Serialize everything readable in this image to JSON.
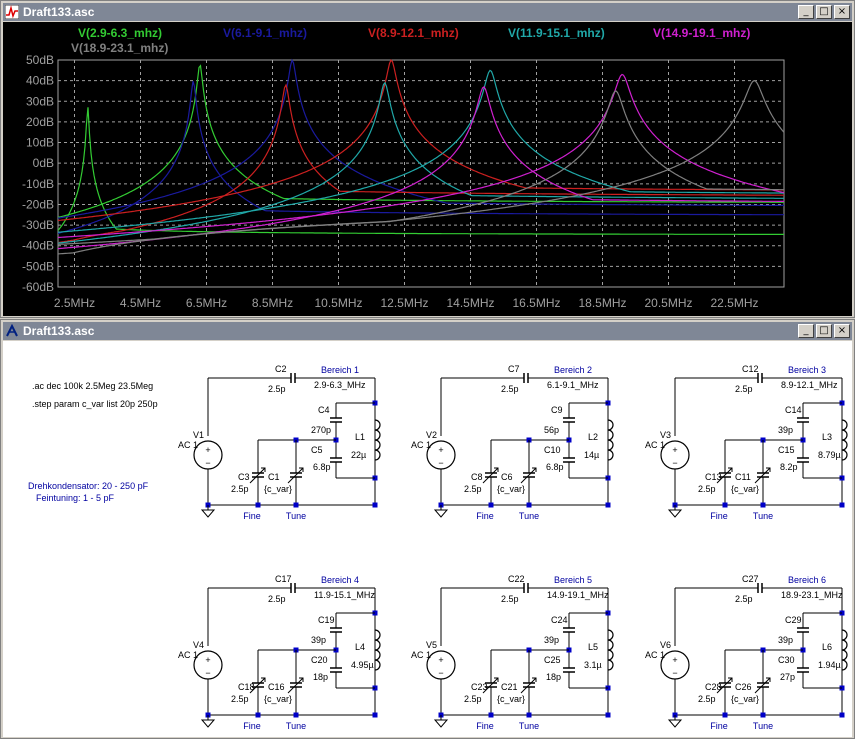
{
  "plot_window": {
    "title": "Draft133.asc",
    "buttons": {
      "minimize": "_",
      "maximize": "□",
      "close": "×"
    }
  },
  "schematic_window": {
    "title": "Draft133.asc",
    "buttons": {
      "minimize": "_",
      "maximize": "□",
      "close": "×"
    }
  },
  "chart_data": {
    "type": "line",
    "title": "",
    "xlabel": "",
    "ylabel": "",
    "x_scale": "linear",
    "xlim": [
      2.0,
      24.0
    ],
    "ylim": [
      -60,
      50
    ],
    "grid": true,
    "legend_position": "top",
    "x_ticks": [
      "2.5MHz",
      "4.5MHz",
      "6.5MHz",
      "8.5MHz",
      "10.5MHz",
      "12.5MHz",
      "14.5MHz",
      "16.5MHz",
      "18.5MHz",
      "20.5MHz",
      "22.5MHz"
    ],
    "y_ticks": [
      "50dB",
      "40dB",
      "30dB",
      "20dB",
      "10dB",
      "0dB",
      "-10dB",
      "-20dB",
      "-30dB",
      "-40dB",
      "-50dB",
      "-60dB"
    ],
    "series": [
      {
        "name": "V(2.9-6.3_mhz)",
        "color": "#33cc33",
        "traces": [
          {
            "peak_mhz": 2.9,
            "peak_db": 28,
            "floor_db": -35
          },
          {
            "peak_mhz": 6.3,
            "peak_db": 48,
            "floor_db": -20
          }
        ]
      },
      {
        "name": "V(6.1-9.1_mhz)",
        "color": "#1a1a9e",
        "traces": [
          {
            "peak_mhz": 6.1,
            "peak_db": 40,
            "floor_db": -26
          },
          {
            "peak_mhz": 9.1,
            "peak_db": 50,
            "floor_db": -22
          }
        ]
      },
      {
        "name": "V(8.9-12.1_mhz)",
        "color": "#cc2020",
        "traces": [
          {
            "peak_mhz": 8.9,
            "peak_db": 38,
            "floor_db": -17
          },
          {
            "peak_mhz": 12.1,
            "peak_db": 50,
            "floor_db": -15
          }
        ]
      },
      {
        "name": "V(11.9-15.1_mhz)",
        "color": "#20a8a8",
        "traces": [
          {
            "peak_mhz": 11.9,
            "peak_db": 39,
            "floor_db": -19
          },
          {
            "peak_mhz": 15.1,
            "peak_db": 45,
            "floor_db": -17
          }
        ]
      },
      {
        "name": "V(14.9-19.1_mhz)",
        "color": "#d020d0",
        "traces": [
          {
            "peak_mhz": 14.9,
            "peak_db": 37,
            "floor_db": -21
          },
          {
            "peak_mhz": 19.1,
            "peak_db": 43,
            "floor_db": -20
          }
        ]
      },
      {
        "name": "V(18.9-23.1_mhz)",
        "color": "#808080",
        "traces": [
          {
            "peak_mhz": 18.9,
            "peak_db": 35,
            "floor_db": -16
          },
          {
            "peak_mhz": 23.1,
            "peak_db": 40,
            "floor_db": -14
          }
        ]
      }
    ]
  },
  "schematic": {
    "directives": [
      ".ac dec 100k 2.5Meg 23.5Meg",
      ".step param c_var list 20p 250p"
    ],
    "notes": [
      "Drehkondensator:  20 - 250 pF",
      "Feintuning:  1 - 5 pF"
    ],
    "stages": [
      {
        "bereich": "Bereich 1",
        "band": "2.9-6.3_MHz",
        "source": "V1",
        "src_type": "AC 1",
        "c_couple": "C2",
        "c_couple_val": "2.5p",
        "c_top": "C4",
        "c_top_val": "270p",
        "c_bot": "C5",
        "c_bot_val": "6.8p",
        "inductor": "L1",
        "ind_val": "22µ",
        "c_fine": "C3",
        "c_fine_val": "2.5p",
        "c_tune": "C1",
        "c_tune_val": "{c_var}",
        "fine_label": "Fine",
        "tune_label": "Tune"
      },
      {
        "bereich": "Bereich 2",
        "band": "6.1-9.1_MHz",
        "source": "V2",
        "src_type": "AC 1",
        "c_couple": "C7",
        "c_couple_val": "2.5p",
        "c_top": "C9",
        "c_top_val": "56p",
        "c_bot": "C10",
        "c_bot_val": "6.8p",
        "inductor": "L2",
        "ind_val": "14µ",
        "c_fine": "C8",
        "c_fine_val": "2.5p",
        "c_tune": "C6",
        "c_tune_val": "{c_var}",
        "fine_label": "Fine",
        "tune_label": "Tune"
      },
      {
        "bereich": "Bereich 3",
        "band": "8.9-12.1_MHz",
        "source": "V3",
        "src_type": "AC 1",
        "c_couple": "C12",
        "c_couple_val": "2.5p",
        "c_top": "C14",
        "c_top_val": "39p",
        "c_bot": "C15",
        "c_bot_val": "8.2p",
        "inductor": "L3",
        "ind_val": "8.79µ",
        "c_fine": "C13",
        "c_fine_val": "2.5p",
        "c_tune": "C11",
        "c_tune_val": "{c_var}",
        "fine_label": "Fine",
        "tune_label": "Tune"
      },
      {
        "bereich": "Bereich 4",
        "band": "11.9-15.1_MHz",
        "source": "V4",
        "src_type": "AC 1",
        "c_couple": "C17",
        "c_couple_val": "2.5p",
        "c_top": "C19",
        "c_top_val": "39p",
        "c_bot": "C20",
        "c_bot_val": "18p",
        "inductor": "L4",
        "ind_val": "4.95µ",
        "c_fine": "C18",
        "c_fine_val": "2.5p",
        "c_tune": "C16",
        "c_tune_val": "{c_var}",
        "fine_label": "Fine",
        "tune_label": "Tune"
      },
      {
        "bereich": "Bereich 5",
        "band": "14.9-19.1_MHz",
        "source": "V5",
        "src_type": "AC 1",
        "c_couple": "C22",
        "c_couple_val": "2.5p",
        "c_top": "C24",
        "c_top_val": "39p",
        "c_bot": "C25",
        "c_bot_val": "18p",
        "inductor": "L5",
        "ind_val": "3.1µ",
        "c_fine": "C23",
        "c_fine_val": "2.5p",
        "c_tune": "C21",
        "c_tune_val": "{c_var}",
        "fine_label": "Fine",
        "tune_label": "Tune"
      },
      {
        "bereich": "Bereich 6",
        "band": "18.9-23.1_MHz",
        "source": "V6",
        "src_type": "AC 1",
        "c_couple": "C27",
        "c_couple_val": "2.5p",
        "c_top": "C29",
        "c_top_val": "39p",
        "c_bot": "C30",
        "c_bot_val": "27p",
        "inductor": "L6",
        "ind_val": "1.94µ",
        "c_fine": "C28",
        "c_fine_val": "2.5p",
        "c_tune": "C26",
        "c_tune_val": "{c_var}",
        "fine_label": "Fine",
        "tune_label": "Tune"
      }
    ]
  }
}
